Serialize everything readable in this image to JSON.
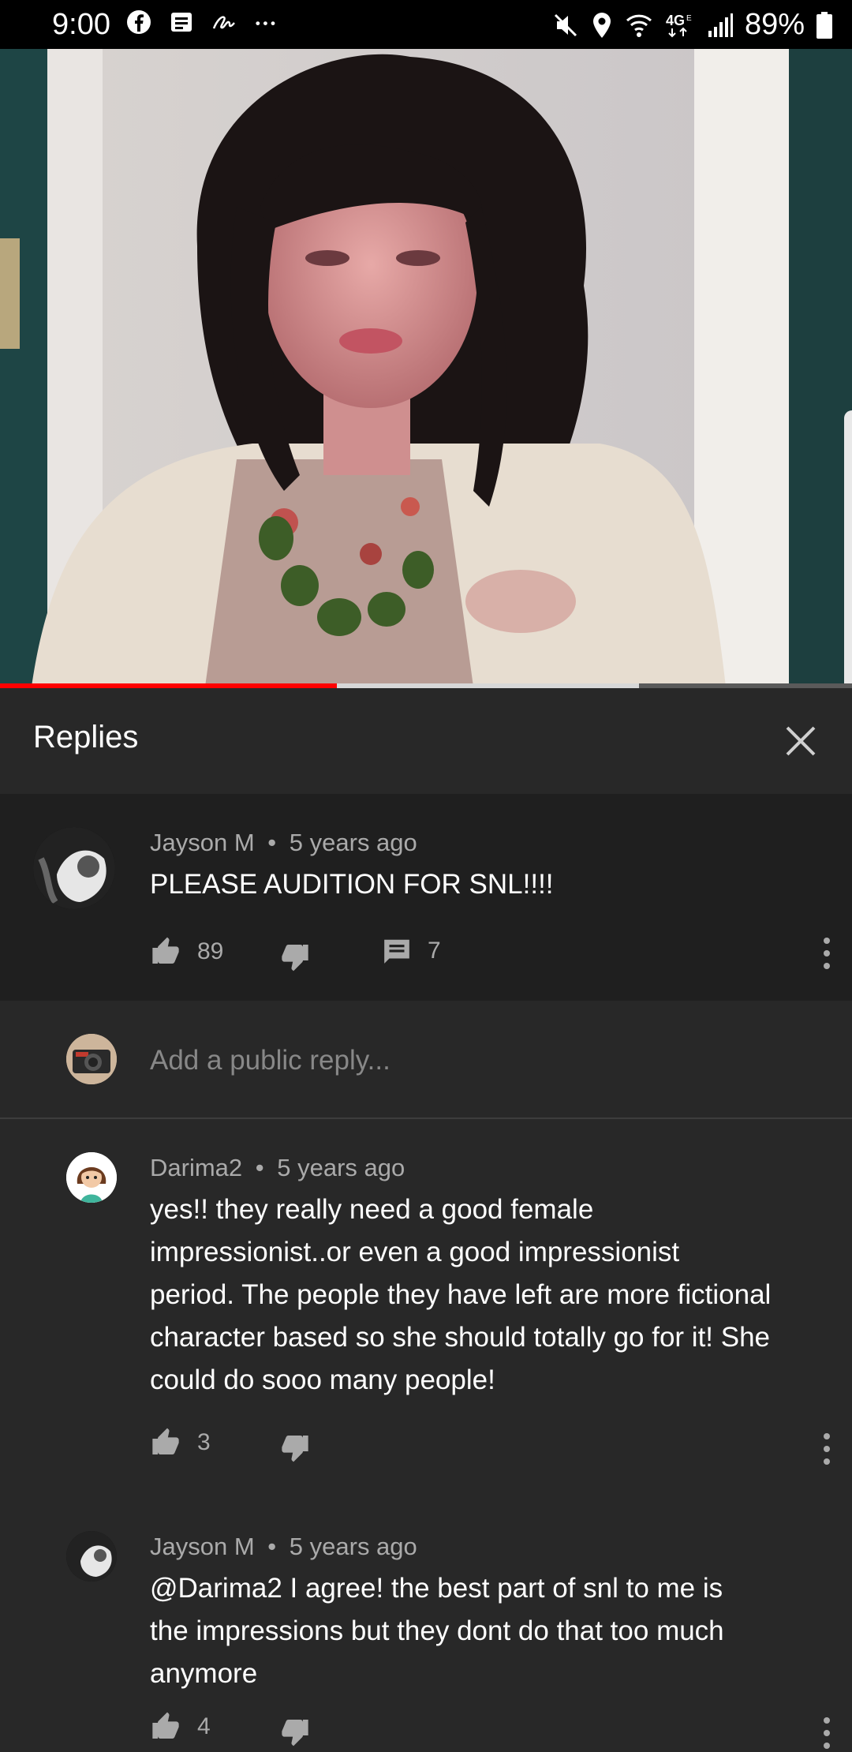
{
  "status_bar": {
    "time": "9:00",
    "battery": "89%",
    "left_icons": [
      "facebook-icon",
      "message-icon",
      "signature-icon",
      "more-dots-icon"
    ],
    "right_icons": [
      "mute-icon",
      "location-icon",
      "wifi-calling-icon",
      "4g-icon",
      "signal-icon",
      "battery-icon"
    ]
  },
  "video": {
    "progress_played": 0.395,
    "progress_buffered": 0.75
  },
  "replies": {
    "title": "Replies"
  },
  "parent_comment": {
    "author": "Jayson M",
    "age": "5 years ago",
    "text": "PLEASE AUDITION FOR SNL!!!!",
    "likes": "89",
    "replies_count": "7"
  },
  "reply_box": {
    "placeholder": "Add a public reply..."
  },
  "comments": [
    {
      "author": "Darima2",
      "age": "5 years ago",
      "text_lines": [
        "yes!! they really need a good female",
        "impressionist..or even a good impressionist",
        "period. The people they have left are more fictional",
        "character based so she should totally go for it! She",
        "could do sooo many people!"
      ],
      "likes": "3"
    },
    {
      "author": "Jayson M",
      "age": "5 years ago",
      "text_lines": [
        "@Darima2 I agree! the best part of snl to me is",
        "the impressions but they dont do that too much",
        "anymore"
      ],
      "likes": "4"
    }
  ],
  "separator": "•",
  "colors": {
    "background": "#282828",
    "parent_background": "#1f1f1f",
    "progress": "#ff0000",
    "secondary_text": "#aaaaaa"
  }
}
